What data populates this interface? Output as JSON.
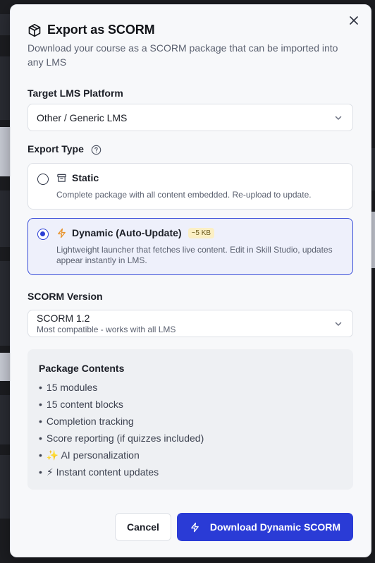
{
  "dialog": {
    "title": "Export as SCORM",
    "subtitle": "Download your course as a SCORM package that can be imported into any LMS",
    "close_icon": "close-icon"
  },
  "target_lms": {
    "label": "Target LMS Platform",
    "value": "Other / Generic LMS"
  },
  "export_type": {
    "label": "Export Type",
    "options": [
      {
        "title": "Static",
        "description": "Complete package with all content embedded. Re-upload to update.",
        "icon": "archive-icon",
        "selected": false
      },
      {
        "title": "Dynamic (Auto-Update)",
        "badge": "~5 KB",
        "description": "Lightweight launcher that fetches live content. Edit in Skill Studio, updates appear instantly in LMS.",
        "icon": "lightning-icon",
        "selected": true
      }
    ]
  },
  "scorm_version": {
    "label": "SCORM Version",
    "value": "SCORM 1.2",
    "hint": "Most compatible - works with all LMS"
  },
  "package_contents": {
    "title": "Package Contents",
    "items": [
      "15 modules",
      "15 content blocks",
      "Completion tracking",
      "Score reporting (if quizzes included)",
      "✨ AI personalization",
      "⚡ Instant content updates"
    ]
  },
  "actions": {
    "cancel_label": "Cancel",
    "download_label": "Download Dynamic SCORM"
  },
  "colors": {
    "accent": "#2a3bd6",
    "selected_bg": "#eef0fb",
    "badge_bg": "#fbefc4",
    "lightning": "#e8932c"
  }
}
